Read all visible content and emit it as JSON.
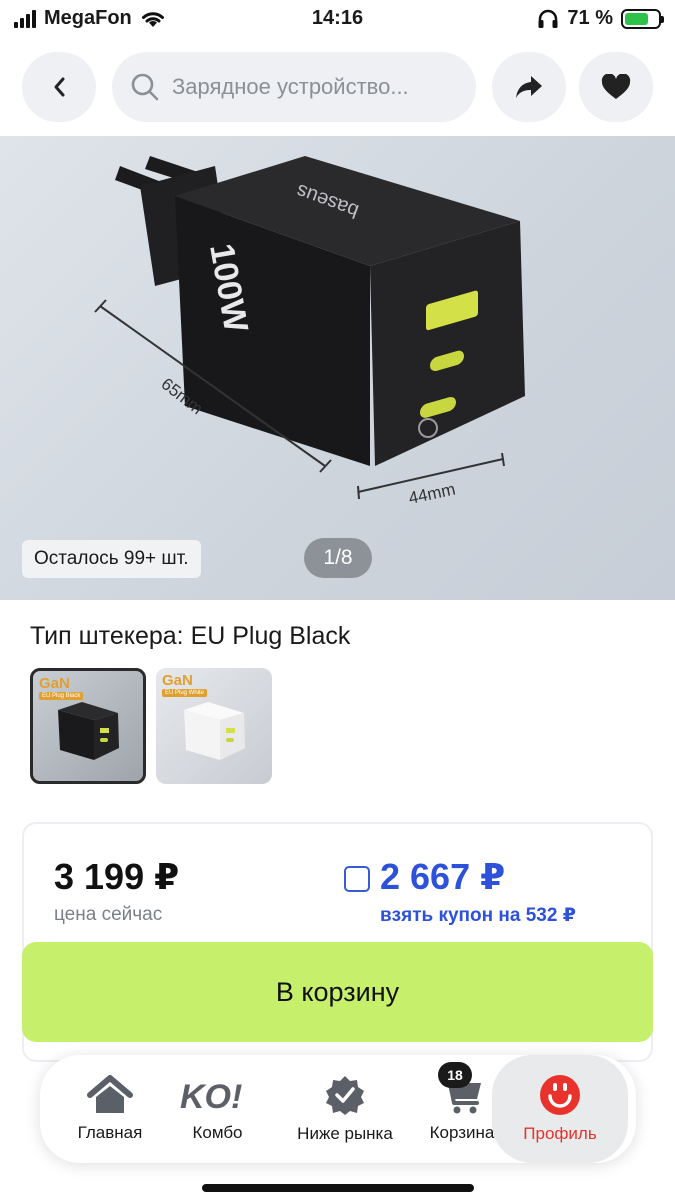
{
  "status_bar": {
    "carrier": "MegaFon",
    "time": "14:16",
    "battery": "71 %",
    "battery_level": 0.71
  },
  "top_bar": {
    "search_text": "Зарядное устройство..."
  },
  "gallery": {
    "stock": "Осталось 99+ шт.",
    "counter": "1/8",
    "brand": "baseus",
    "power": "100W",
    "dim_length": "65mm",
    "dim_width": "44mm"
  },
  "variants": {
    "title": "Тип штекера: EU Plug Black",
    "items": [
      {
        "badge": "GaN",
        "sub": "EU Plug Black"
      },
      {
        "badge": "GaN",
        "sub": "EU Plug White"
      }
    ]
  },
  "price": {
    "current": "3 199 ₽",
    "current_label": "цена сейчас",
    "coupon_price": "2 667 ₽",
    "coupon_label": "взять купон на 532 ₽"
  },
  "cart_button": "В корзину",
  "nav": {
    "home": "Главная",
    "combo": "Комбо",
    "combo_logo": "KO!",
    "market": "Ниже рынка",
    "cart": "Корзина",
    "cart_count": "18",
    "profile": "Профиль"
  },
  "colors": {
    "accent_green": "#c6f06c",
    "coupon_blue": "#2d51d8",
    "profile_red": "#e8322b"
  }
}
